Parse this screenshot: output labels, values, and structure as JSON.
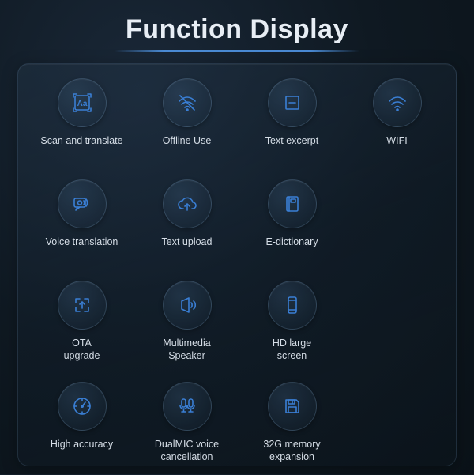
{
  "title": "Function Display",
  "features": [
    {
      "id": "scan-translate",
      "label": "Scan and translate",
      "icon": "scan-translate-icon"
    },
    {
      "id": "offline-use",
      "label": "Offline Use",
      "icon": "wifi-off-icon"
    },
    {
      "id": "text-excerpt",
      "label": "Text excerpt",
      "icon": "text-excerpt-icon"
    },
    {
      "id": "wifi",
      "label": "WIFI",
      "icon": "wifi-icon"
    },
    {
      "id": "voice-translation",
      "label": "Voice translation",
      "icon": "voice-translation-icon"
    },
    {
      "id": "text-upload",
      "label": "Text upload",
      "icon": "cloud-upload-icon"
    },
    {
      "id": "e-dictionary",
      "label": "E-dictionary",
      "icon": "dictionary-icon"
    },
    {
      "id": "ota-upgrade",
      "label": "OTA\nupgrade",
      "icon": "ota-upgrade-icon"
    },
    {
      "id": "multimedia-speaker",
      "label": "Multimedia\nSpeaker",
      "icon": "speaker-icon"
    },
    {
      "id": "hd-screen",
      "label": "HD large\nscreen",
      "icon": "screen-icon"
    },
    {
      "id": "high-accuracy",
      "label": "High accuracy",
      "icon": "accuracy-icon"
    },
    {
      "id": "dual-mic",
      "label": "DualMIC voice\ncancellation",
      "icon": "dual-mic-icon"
    },
    {
      "id": "storage-expansion",
      "label": "32G memory\nexpansion",
      "icon": "storage-icon"
    }
  ],
  "grid_positions": [
    0,
    1,
    2,
    3,
    4,
    5,
    6,
    null,
    8,
    9,
    10,
    null,
    12,
    13,
    14,
    null
  ],
  "colors": {
    "accent": "#3a7fd5",
    "text": "#d5dde6",
    "title": "#e8eef5"
  }
}
